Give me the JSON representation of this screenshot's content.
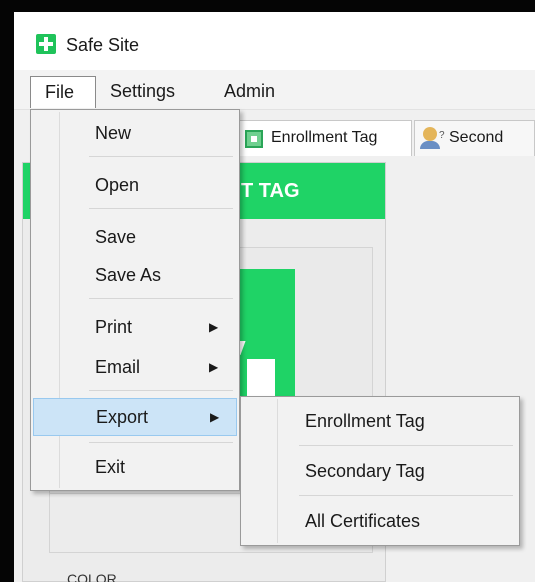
{
  "window": {
    "title": "Safe Site"
  },
  "menubar": {
    "file": "File",
    "settings": "Settings",
    "admin": "Admin"
  },
  "tabs": [
    {
      "label": "Enrollment Tag"
    },
    {
      "label": "Second"
    }
  ],
  "panel": {
    "header_partial": "T TAG",
    "color_label": "COLOR"
  },
  "file_menu": {
    "items": [
      {
        "label": "New"
      },
      {
        "label": "Open"
      },
      {
        "label": "Save"
      },
      {
        "label": "Save As"
      },
      {
        "label": "Print",
        "has_submenu": true
      },
      {
        "label": "Email",
        "has_submenu": true
      },
      {
        "label": "Export",
        "has_submenu": true,
        "highlighted": true
      },
      {
        "label": "Exit"
      }
    ]
  },
  "export_submenu": {
    "items": [
      {
        "label": "Enrollment Tag"
      },
      {
        "label": "Secondary Tag"
      },
      {
        "label": "All Certificates"
      }
    ]
  },
  "colors": {
    "accent_green": "#1fd366",
    "highlight": "#cce4f7"
  }
}
